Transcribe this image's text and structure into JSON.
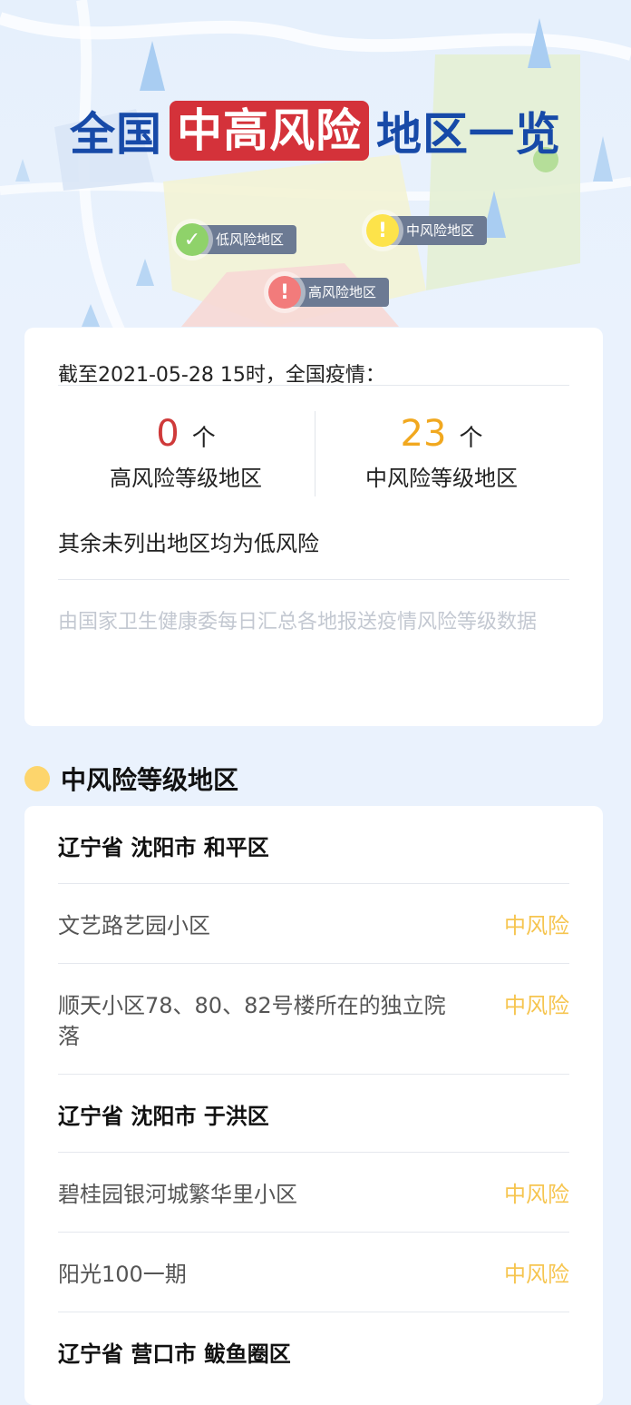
{
  "hero": {
    "title_prefix": "全国",
    "title_highlight": "中高风险",
    "title_suffix": "地区一览",
    "legend": {
      "low": "低风险地区",
      "mid": "中风险地区",
      "high": "高风险地区"
    },
    "colors": {
      "low": "#8fd26a",
      "mid": "#fde34a",
      "high": "#f27b7b",
      "title": "#174aa8",
      "highlight": "#d4323a"
    }
  },
  "summary": {
    "as_of": "截至2021-05-28 15时，全国疫情：",
    "high": {
      "count": "0",
      "unit": "个",
      "label": "高风险等级地区",
      "color": "#cf3a3a"
    },
    "mid": {
      "count": "23",
      "unit": "个",
      "label": "中风险等级地区",
      "color": "#f1a81f"
    },
    "rest": "其余未列出地区均为低风险",
    "source": "由国家卫生健康委每日汇总各地报送疫情风险等级数据"
  },
  "section": {
    "title": "中风险等级地区",
    "groups": [
      {
        "region": "辽宁省 沈阳市 和平区",
        "items": [
          {
            "name": "文艺路艺园小区",
            "level": "中风险"
          },
          {
            "name": "顺天小区78、80、82号楼所在的独立院落",
            "level": "中风险"
          }
        ]
      },
      {
        "region": "辽宁省 沈阳市 于洪区",
        "items": [
          {
            "name": "碧桂园银河城繁华里小区",
            "level": "中风险"
          },
          {
            "name": "阳光100一期",
            "level": "中风险"
          }
        ]
      },
      {
        "region": "辽宁省 营口市 鲅鱼圈区",
        "items": []
      }
    ]
  }
}
